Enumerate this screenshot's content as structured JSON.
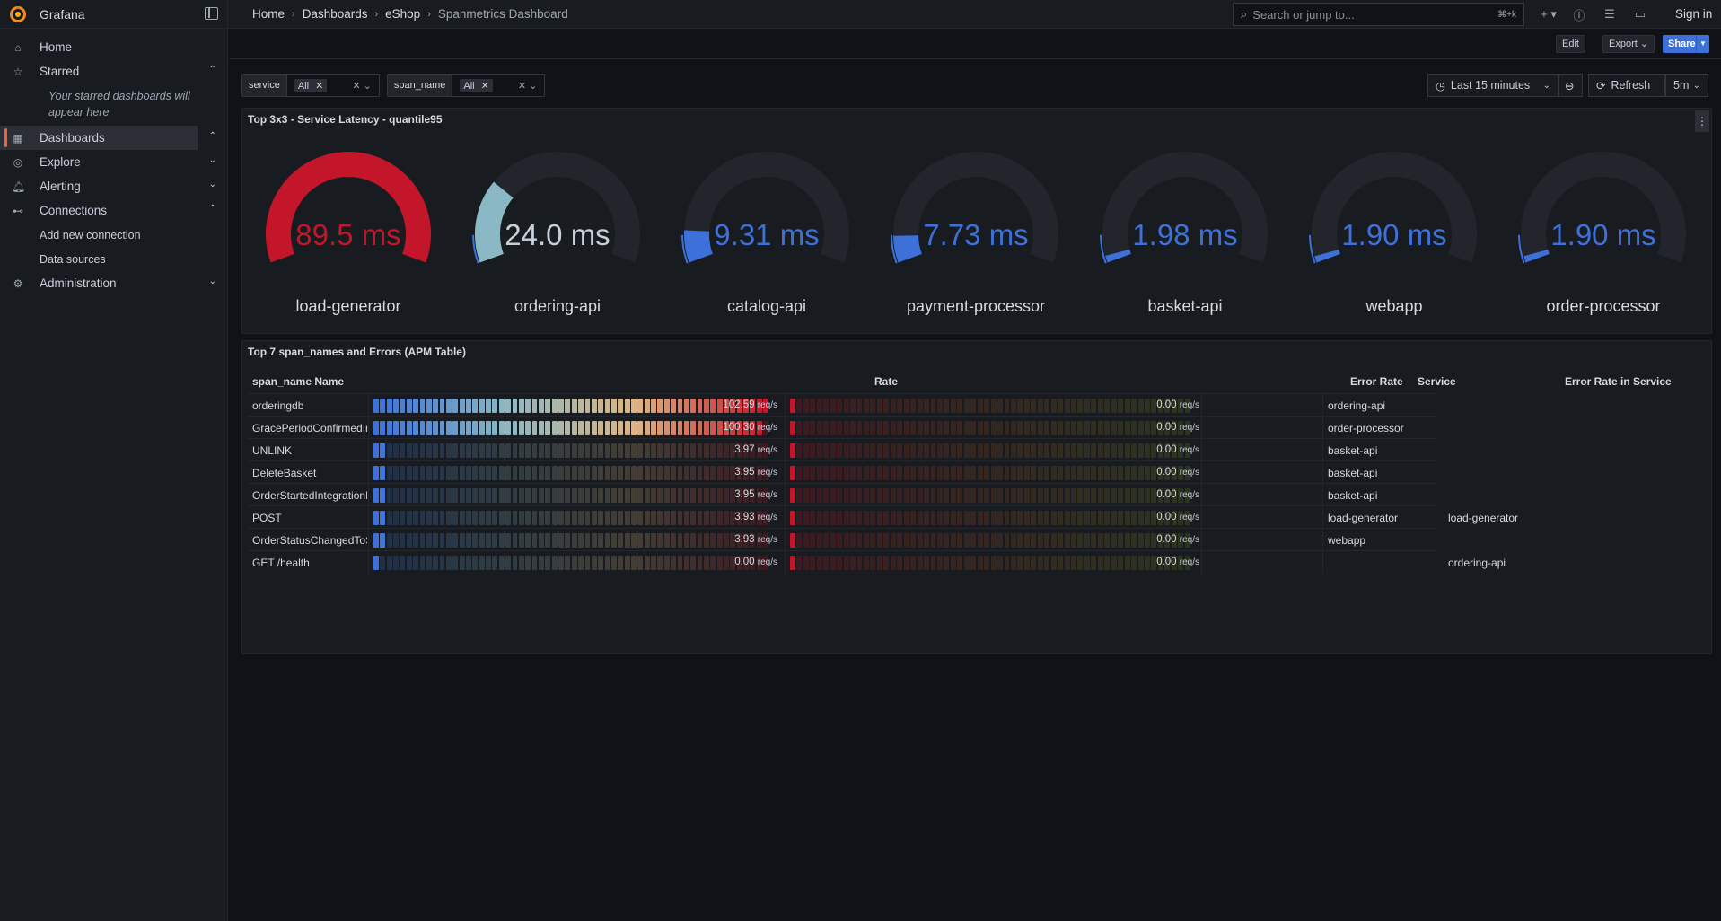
{
  "app": {
    "name": "Grafana",
    "sign_in": "Sign in"
  },
  "breadcrumbs": [
    "Home",
    "Dashboards",
    "eShop",
    "Spanmetrics Dashboard"
  ],
  "search": {
    "placeholder": "Search or jump to...",
    "shortcut": "⌘+k"
  },
  "sidebar": {
    "items": [
      {
        "label": "Home",
        "icon": "home-icon"
      },
      {
        "label": "Starred",
        "icon": "star-icon",
        "expanded": true
      },
      {
        "label": "Dashboards",
        "icon": "apps-icon",
        "expanded": true,
        "active": true
      },
      {
        "label": "Explore",
        "icon": "compass-icon"
      },
      {
        "label": "Alerting",
        "icon": "bell-icon"
      },
      {
        "label": "Connections",
        "icon": "plug-icon",
        "expanded": true
      },
      {
        "label": "Administration",
        "icon": "cog-icon"
      }
    ],
    "starred_empty": "Your starred dashboards will appear here",
    "connections_sub": [
      "Add new connection",
      "Data sources"
    ]
  },
  "toolbar": {
    "edit": "Edit",
    "export": "Export",
    "share": "Share"
  },
  "variables": [
    {
      "label": "service",
      "value": "All"
    },
    {
      "label": "span_name",
      "value": "All"
    }
  ],
  "time": {
    "range": "Last 15 minutes",
    "refresh": "Refresh",
    "interval": "5m"
  },
  "gauge_panel": {
    "title": "Top 3x3 - Service Latency - quantile95",
    "gauges": [
      {
        "value": "89.5 ms",
        "name": "load-generator",
        "fraction": 1.0,
        "color": "#c4162a"
      },
      {
        "value": "24.0 ms",
        "name": "ordering-api",
        "fraction": 0.27,
        "color": "#8ab8c4"
      },
      {
        "value": "9.31 ms",
        "name": "catalog-api",
        "fraction": 0.104,
        "color": "#3d71d9"
      },
      {
        "value": "7.73 ms",
        "name": "payment-processor",
        "fraction": 0.086,
        "color": "#3d71d9"
      },
      {
        "value": "1.98 ms",
        "name": "basket-api",
        "fraction": 0.022,
        "color": "#3d71d9"
      },
      {
        "value": "1.90 ms",
        "name": "webapp",
        "fraction": 0.021,
        "color": "#3d71d9"
      },
      {
        "value": "1.90 ms",
        "name": "order-processor",
        "fraction": 0.021,
        "color": "#3d71d9"
      }
    ]
  },
  "apm_panel": {
    "title": "Top 7 span_names and Errors (APM Table)",
    "columns": [
      "span_name Name",
      "Rate",
      "Error Rate",
      "Service",
      "Error Rate in Service"
    ],
    "rows": [
      {
        "name": "orderingdb",
        "rate": "102.59",
        "rate_frac": 1.0,
        "err": "0.00",
        "service": "ordering-api",
        "err_service": ""
      },
      {
        "name": "GracePeriodConfirmedInteg",
        "rate": "100.30",
        "rate_frac": 0.98,
        "err": "0.00",
        "service": "order-processor",
        "err_service": ""
      },
      {
        "name": "UNLINK",
        "rate": "3.97",
        "rate_frac": 0.04,
        "err": "0.00",
        "service": "basket-api",
        "err_service": ""
      },
      {
        "name": "DeleteBasket",
        "rate": "3.95",
        "rate_frac": 0.04,
        "err": "0.00",
        "service": "basket-api",
        "err_service": ""
      },
      {
        "name": "OrderStartedIntegrationEve",
        "rate": "3.95",
        "rate_frac": 0.04,
        "err": "0.00",
        "service": "basket-api",
        "err_service": ""
      },
      {
        "name": "POST",
        "rate": "3.93",
        "rate_frac": 0.04,
        "err": "0.00",
        "service": "load-generator",
        "err_service": "load-generator"
      },
      {
        "name": "OrderStatusChangedToSub",
        "rate": "3.93",
        "rate_frac": 0.04,
        "err": "0.00",
        "service": "webapp",
        "err_service": ""
      },
      {
        "name": "GET /health",
        "rate": "0.00",
        "rate_frac": 0.005,
        "err": "0.00",
        "service": "",
        "err_service": "ordering-api"
      }
    ],
    "unit": "req/s"
  }
}
